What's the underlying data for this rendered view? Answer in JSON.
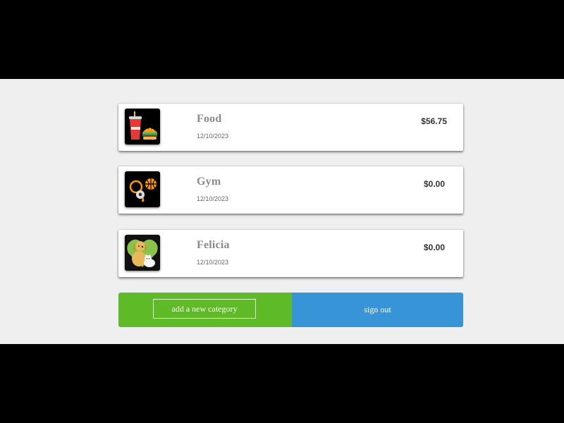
{
  "categories": [
    {
      "name": "Food",
      "date": "12/10/2023",
      "amount": "$56.75",
      "icon": "food-drink-burger-icon"
    },
    {
      "name": "Gym",
      "date": "12/10/2023",
      "amount": "$0.00",
      "icon": "sports-equipment-icon"
    },
    {
      "name": "Felicia",
      "date": "12/10/2023",
      "amount": "$0.00",
      "icon": "pets-dog-cat-icon"
    }
  ],
  "actions": {
    "add_label": "add a new category",
    "signout_label": "sign out"
  },
  "colors": {
    "add_bg": "#5fba27",
    "signout_bg": "#3794d6",
    "page_bg": "#efefef",
    "name_color": "#8a8a8a"
  }
}
